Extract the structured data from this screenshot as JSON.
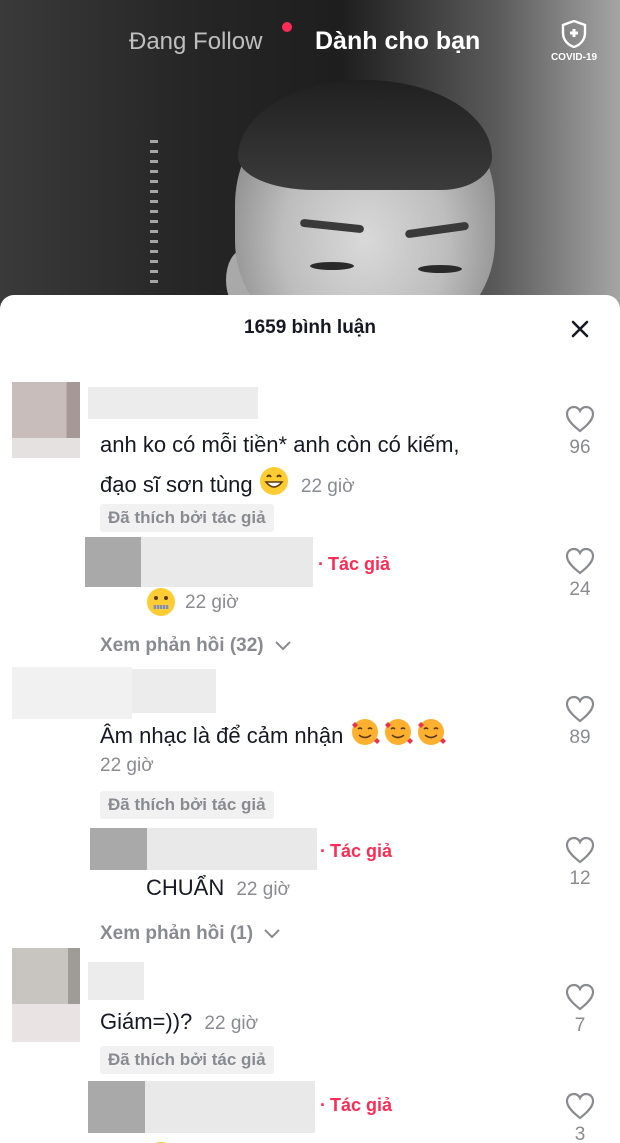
{
  "top_nav": {
    "following_label": "Đang Follow",
    "for_you_label": "Dành cho bạn",
    "covid_label": "COVID-19"
  },
  "comments_panel": {
    "title": "1659 bình luận",
    "close_icon": "close-icon",
    "comments": [
      {
        "text": "anh ko có mỗi tiền* anh còn có kiếm,",
        "text_line2": "đạo sĩ sơn tùng",
        "emoji": "grinning-face",
        "time": "22 giờ",
        "author_liked": "Đã thích bởi tác giả",
        "likes": "96",
        "reply": {
          "author_tag": "Tác giả",
          "emoji": "zipper-mouth-face",
          "time": "22 giờ",
          "likes": "24"
        },
        "view_replies": "Xem phản hồi (32)"
      },
      {
        "text": "Âm nhạc là để cảm nhận",
        "emoji": "smiling-face-with-hearts x3",
        "time": "22 giờ",
        "author_liked": "Đã thích bởi tác giả",
        "likes": "89",
        "reply": {
          "author_tag": "Tác giả",
          "text": "CHUẨN",
          "time": "22 giờ",
          "likes": "12"
        },
        "view_replies": "Xem phản hồi (1)"
      },
      {
        "text": "Giám=))?",
        "time": "22 giờ",
        "author_liked": "Đã thích bởi tác giả",
        "likes": "7",
        "reply": {
          "author_tag": "Tác giả",
          "likes": "3"
        }
      }
    ]
  },
  "colors": {
    "accent_red": "#fe2c55",
    "muted_text": "#8a8b91",
    "primary_text": "#161823"
  }
}
